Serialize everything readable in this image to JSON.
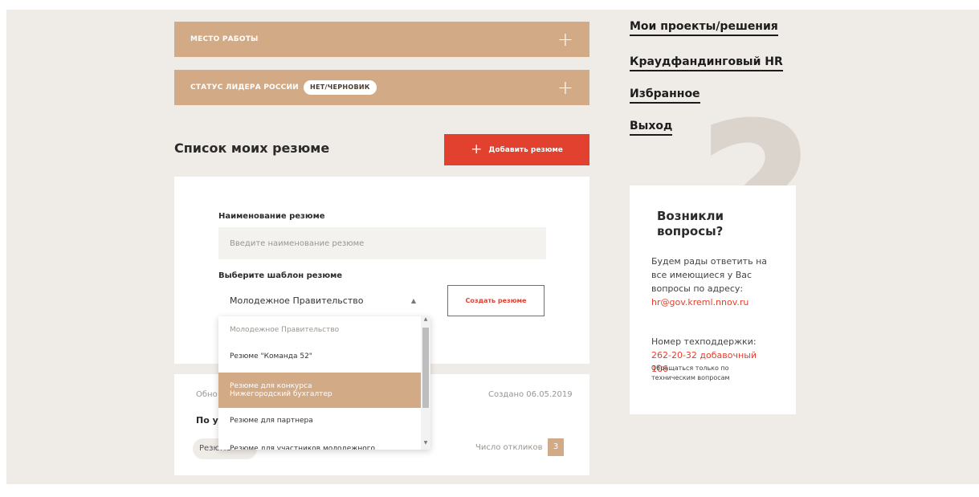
{
  "accordion": [
    {
      "title": "МЕСТО РАБОТЫ",
      "plus": "+"
    },
    {
      "title": "СТАТУС ЛИДЕРА РОССИИ",
      "badge": "НЕТ/ЧЕРНОВИК",
      "plus": "+"
    }
  ],
  "resumes": {
    "title": "Список моих резюме",
    "add_button": "Добавить резюме",
    "add_icon": "+"
  },
  "form": {
    "name_label": "Наименование резюме",
    "name_placeholder": "Введите наименование резюме",
    "template_label": "Выберите шаблон резюме",
    "template_selected": "Молодежное Правительство",
    "create_button": "Создать резюме"
  },
  "dropdown": {
    "options": [
      "Молодежное Правительство",
      "Резюме \"Команда 52\"",
      "Резюме для конкурса Нижегородский бухгалтер",
      "Резюме для партнера",
      "Резюме для участников молодежного"
    ]
  },
  "resume_card": {
    "updated": "Обно",
    "created": "Создано 06.05.2019",
    "heading": "По ук",
    "pill": "Резюме",
    "responses_label": "Число откликов",
    "responses_count": "3"
  },
  "nav": [
    "Мои проекты/решения",
    "Краудфандинговый HR",
    "Избранное",
    "Выход"
  ],
  "help": {
    "qmark": "?",
    "title": "Возникли вопросы?",
    "text": "Будем рады ответить на все имеющиеся у Вас вопросы по адресу:",
    "email": "hr@gov.kreml.nnov.ru",
    "support_label": "Номер техподдержки:",
    "phone": "262-20-32 добавочный 106",
    "note": "Обращаться только по техническим вопросам"
  },
  "colors": {
    "accent": "#d3aa86",
    "red": "#e2412f",
    "background": "#efebe7"
  }
}
